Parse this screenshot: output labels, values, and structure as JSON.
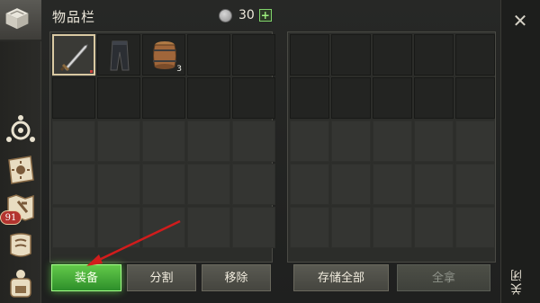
{
  "header": {
    "title": "物品栏",
    "currency_amount": "30",
    "plus_label": "+"
  },
  "rail": {
    "badge": "91",
    "icons": [
      "chest-icon",
      "compass-icon",
      "sun-book-icon",
      "map-icon",
      "scroll-icon",
      "backpack-icon"
    ]
  },
  "inventory": {
    "items": [
      {
        "slot": 0,
        "name": "sword-icon",
        "qty": "",
        "selected": true
      },
      {
        "slot": 1,
        "name": "pants-icon",
        "qty": ""
      },
      {
        "slot": 2,
        "name": "barrel-icon",
        "qty": "3"
      }
    ]
  },
  "buttons": {
    "equip": "装备",
    "split": "分割",
    "remove": "移除",
    "store_all": "存储全部",
    "take_all": "全拿"
  },
  "close": {
    "x": "✕",
    "label": "关闭"
  },
  "colors": {
    "equip_button": "#4fb83c",
    "arrow": "#d11c1c",
    "badge": "#b3342f"
  }
}
